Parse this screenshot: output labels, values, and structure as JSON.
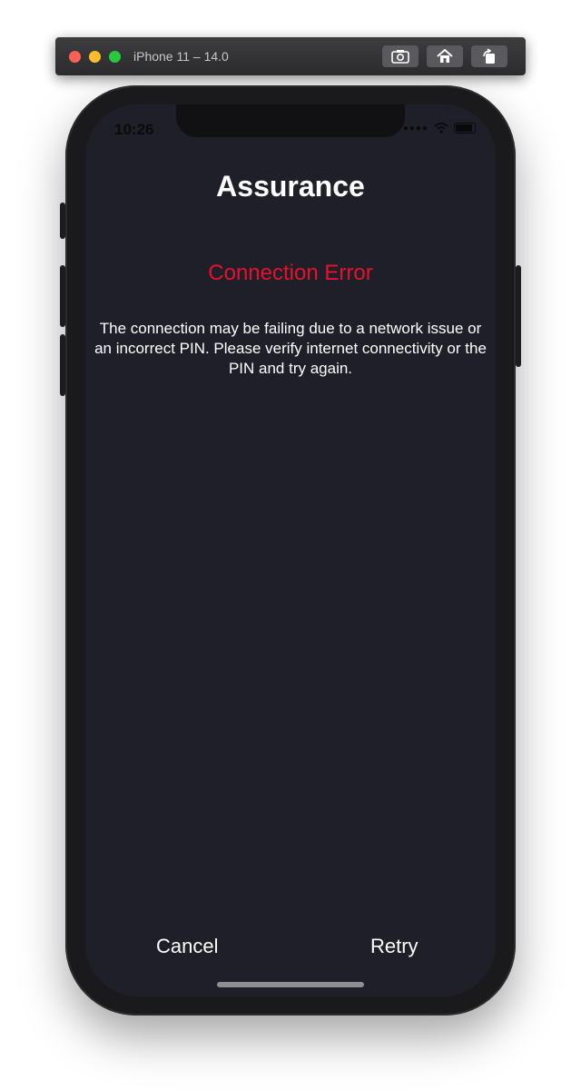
{
  "simulator": {
    "title": "iPhone 11 – 14.0",
    "buttons": [
      "screenshot-icon",
      "home-icon",
      "rotate-icon"
    ]
  },
  "status_bar": {
    "time": "10:26"
  },
  "screen": {
    "title": "Assurance",
    "error_title": "Connection Error",
    "message_lines": [
      "The connection may be failing due to a network issue or",
      "an incorrect PIN. Please verify internet connectivity or the",
      "PIN and try again."
    ],
    "cancel_label": "Cancel",
    "retry_label": "Retry"
  },
  "colors": {
    "background": "#1f1f29",
    "error": "#e8112d",
    "text": "#ffffff"
  }
}
